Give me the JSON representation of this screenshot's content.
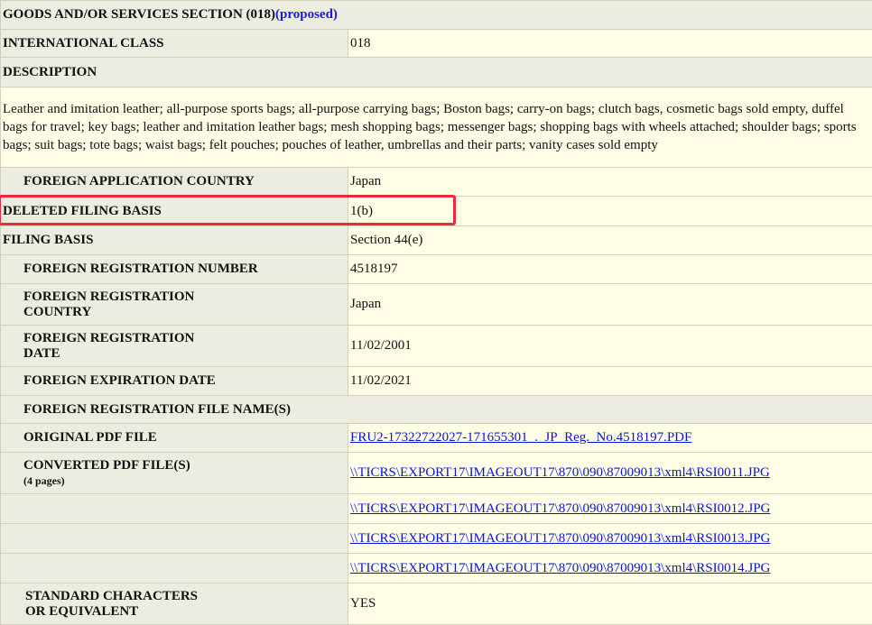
{
  "section": {
    "title": "GOODS AND/OR SERVICES SECTION (018)",
    "proposed": "(proposed)"
  },
  "international_class": {
    "label": "INTERNATIONAL CLASS",
    "value": "018"
  },
  "description": {
    "label": "DESCRIPTION",
    "text": "Leather and imitation leather; all-purpose sports bags; all-purpose carrying bags; Boston bags; carry-on bags; clutch bags, cosmetic bags sold empty, duffel bags for travel; key bags; leather and imitation leather bags; mesh shopping bags; messenger bags; shopping bags with wheels attached; shoulder bags; sports bags; suit bags; tote bags; waist bags; felt pouches; pouches of leather, umbrellas and their parts; vanity cases sold empty"
  },
  "foreign_application_country": {
    "label": "FOREIGN APPLICATION COUNTRY",
    "value": "Japan"
  },
  "deleted_filing_basis": {
    "label": "DELETED FILING BASIS",
    "value": "1(b)"
  },
  "filing_basis": {
    "label": "FILING BASIS",
    "value": "Section 44(e)"
  },
  "foreign_registration_number": {
    "label": "FOREIGN REGISTRATION NUMBER",
    "value": "4518197"
  },
  "foreign_registration_country": {
    "label_line1": "FOREIGN REGISTRATION",
    "label_line2": "COUNTRY",
    "value": "Japan"
  },
  "foreign_registration_date": {
    "label_line1": "FOREIGN REGISTRATION",
    "label_line2": "DATE",
    "value": "11/02/2001"
  },
  "foreign_expiration_date": {
    "label": "FOREIGN EXPIRATION DATE",
    "value": "11/02/2021"
  },
  "file_names": {
    "label": "FOREIGN REGISTRATION FILE NAME(S)"
  },
  "original_pdf": {
    "label": "ORIGINAL PDF FILE",
    "link": "FRU2-17322722027-171655301_._JP_Reg._No.4518197.PDF"
  },
  "converted_pdf": {
    "label": "CONVERTED PDF FILE(S)",
    "pages": "(4 pages)",
    "links": [
      "\\\\TICRS\\EXPORT17\\IMAGEOUT17\\870\\090\\87009013\\xml4\\RSI0011.JPG",
      "\\\\TICRS\\EXPORT17\\IMAGEOUT17\\870\\090\\87009013\\xml4\\RSI0012.JPG",
      "\\\\TICRS\\EXPORT17\\IMAGEOUT17\\870\\090\\87009013\\xml4\\RSI0013.JPG",
      "\\\\TICRS\\EXPORT17\\IMAGEOUT17\\870\\090\\87009013\\xml4\\RSI0014.JPG"
    ]
  },
  "standard_characters": {
    "label_line1": "STANDARD CHARACTERS",
    "label_line2": "OR EQUIVALENT",
    "value": "YES"
  },
  "colors": {
    "highlight": "#ee2a3a",
    "link": "#0a13d8",
    "proposed": "#1c1cd8",
    "label_bg": "#ecece0",
    "value_bg": "#ffffe8"
  }
}
